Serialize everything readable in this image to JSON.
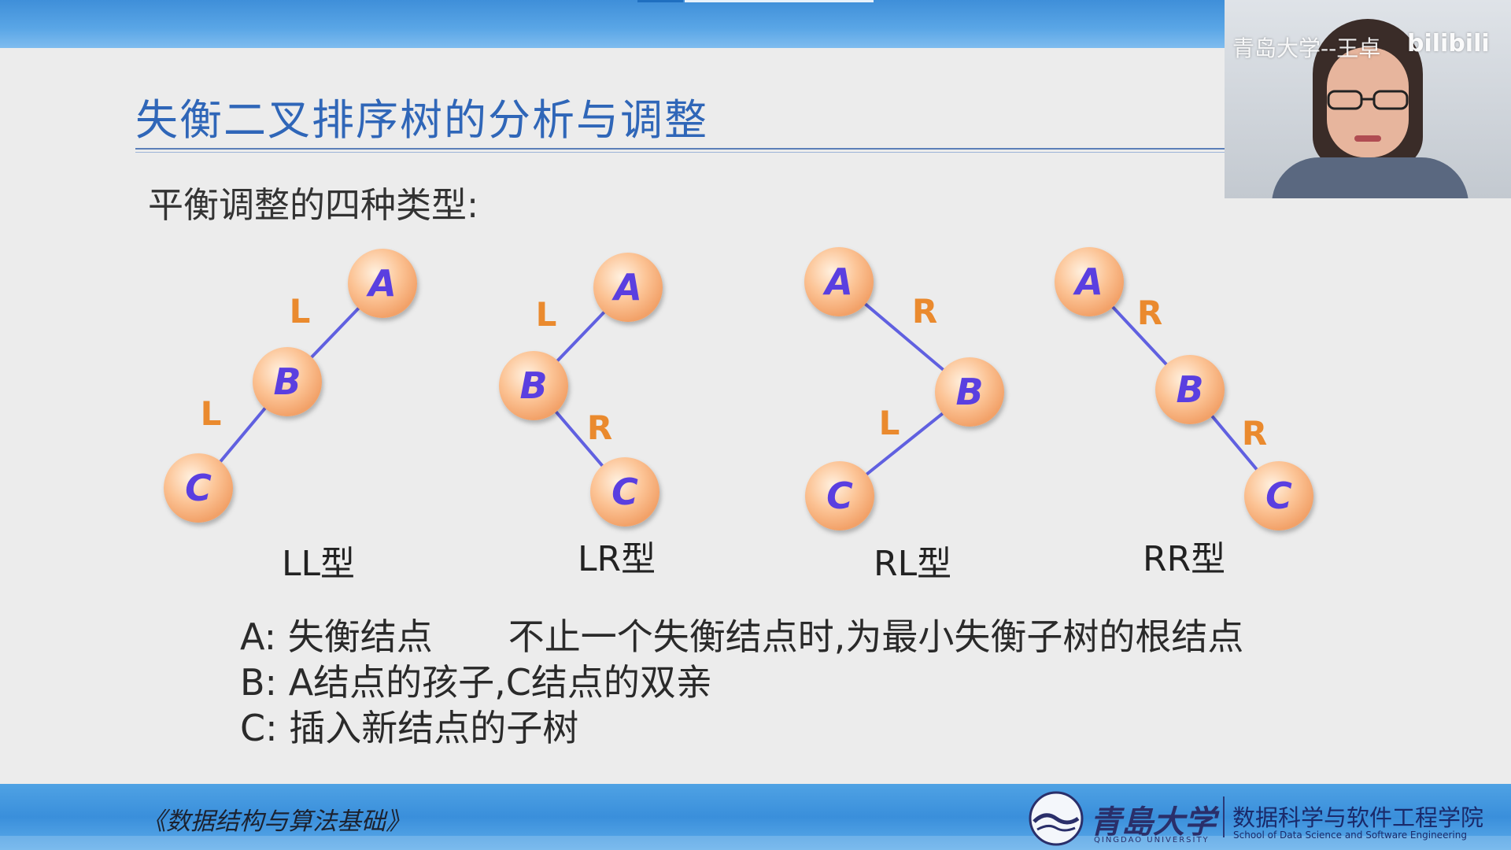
{
  "slide": {
    "title": "失衡二叉排序树的分析与调整",
    "subtitle": "平衡调整的四种类型:",
    "cases": [
      {
        "type_label": "LL型",
        "nodes": {
          "A": "A",
          "B": "B",
          "C": "C"
        },
        "edge_labels": [
          "L",
          "L"
        ]
      },
      {
        "type_label": "LR型",
        "nodes": {
          "A": "A",
          "B": "B",
          "C": "C"
        },
        "edge_labels": [
          "L",
          "R"
        ]
      },
      {
        "type_label": "RL型",
        "nodes": {
          "A": "A",
          "B": "B",
          "C": "C"
        },
        "edge_labels": [
          "R",
          "L"
        ]
      },
      {
        "type_label": "RR型",
        "nodes": {
          "A": "A",
          "B": "B",
          "C": "C"
        },
        "edge_labels": [
          "R",
          "R"
        ]
      }
    ],
    "notes": [
      {
        "key": "A:",
        "text": "失衡结点",
        "extra": "不止一个失衡结点时,为最小失衡子树的根结点"
      },
      {
        "key": "B:",
        "text": "A结点的孩子,C结点的双亲"
      },
      {
        "key": "C:",
        "text": "插入新结点的子树"
      }
    ]
  },
  "footer": {
    "course": "《数据结构与算法基础》",
    "university": "青島大学",
    "university_en": "QINGDAO UNIVERSITY",
    "school_cn": "数据科学与软件工程学院",
    "school_en": "School of Data Science and Software Engineering"
  },
  "webcam": {
    "overlay": "青岛大学--王卓",
    "platform": "bilibili"
  },
  "colors": {
    "title": "#2f66b8",
    "node_fill": "#fcc496",
    "node_label": "#5a3fe0",
    "edge": "#6060e0",
    "edge_label": "#ea8a2e",
    "bar": "#3a8fdb"
  }
}
